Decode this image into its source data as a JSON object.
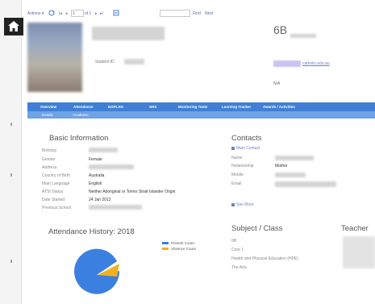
{
  "toolbar": {
    "actions": "Actions ▾",
    "page_num": "1",
    "of_pages": "of 1",
    "first": "|◂",
    "prev": "◂",
    "next": "▸",
    "last": "▸|",
    "find": "Find",
    "next_label": "Next"
  },
  "profile": {
    "student_id_label": "Student ID",
    "class_name": "6B",
    "email_suffix": "catholic.edu.au",
    "na": "N/A"
  },
  "nav_tabs": [
    "Overview",
    "Attendance",
    "NAPLAN",
    "SRS",
    "Monitoring Tools",
    "Learning Tracker",
    "Awards / Activities"
  ],
  "sub_tabs": [
    "Details",
    "Academic"
  ],
  "basic_info": {
    "title": "Basic Information",
    "rows": [
      {
        "label": "Birthday",
        "value": ""
      },
      {
        "label": "Gender",
        "value": "Female"
      },
      {
        "label": "Address",
        "value": ""
      },
      {
        "label": "Country of Birth",
        "value": "Australia"
      },
      {
        "label": "Main Language",
        "value": "English"
      },
      {
        "label": "ATSI Status",
        "value": "Neither Aboriginal or Torres Strait Islander Origin"
      },
      {
        "label": "Date Started",
        "value": "24 Jan 2012"
      },
      {
        "label": "Previous School",
        "value": ""
      }
    ]
  },
  "contacts": {
    "title": "Contacts",
    "main_contact": "Main Contact",
    "rows": [
      {
        "label": "Name",
        "value": ""
      },
      {
        "label": "Relationship",
        "value": "Mother"
      },
      {
        "label": "Mobile",
        "value": ""
      },
      {
        "label": "Email",
        "value": ""
      }
    ],
    "see_more": "See More"
  },
  "attendance": {
    "title": "Attendance History: 2018",
    "legend": [
      {
        "name": "Present Count",
        "color": "#3b7fe0"
      },
      {
        "name": "Absence Count",
        "color": "#f2b01e"
      }
    ]
  },
  "subjects": {
    "title": "Subject / Class",
    "items": [
      "6B",
      "Core 1",
      "Health and Physical Education (HPE)",
      "The Arts"
    ]
  },
  "teacher": {
    "title": "Teacher"
  },
  "colors": {
    "nav": "#3f7fd6",
    "subnav": "#6fa2e6",
    "present": "#3b7fe0",
    "absence": "#f2b01e"
  },
  "icons": {
    "home": "home-icon",
    "refresh": "refresh-icon",
    "export": "export-icon"
  }
}
